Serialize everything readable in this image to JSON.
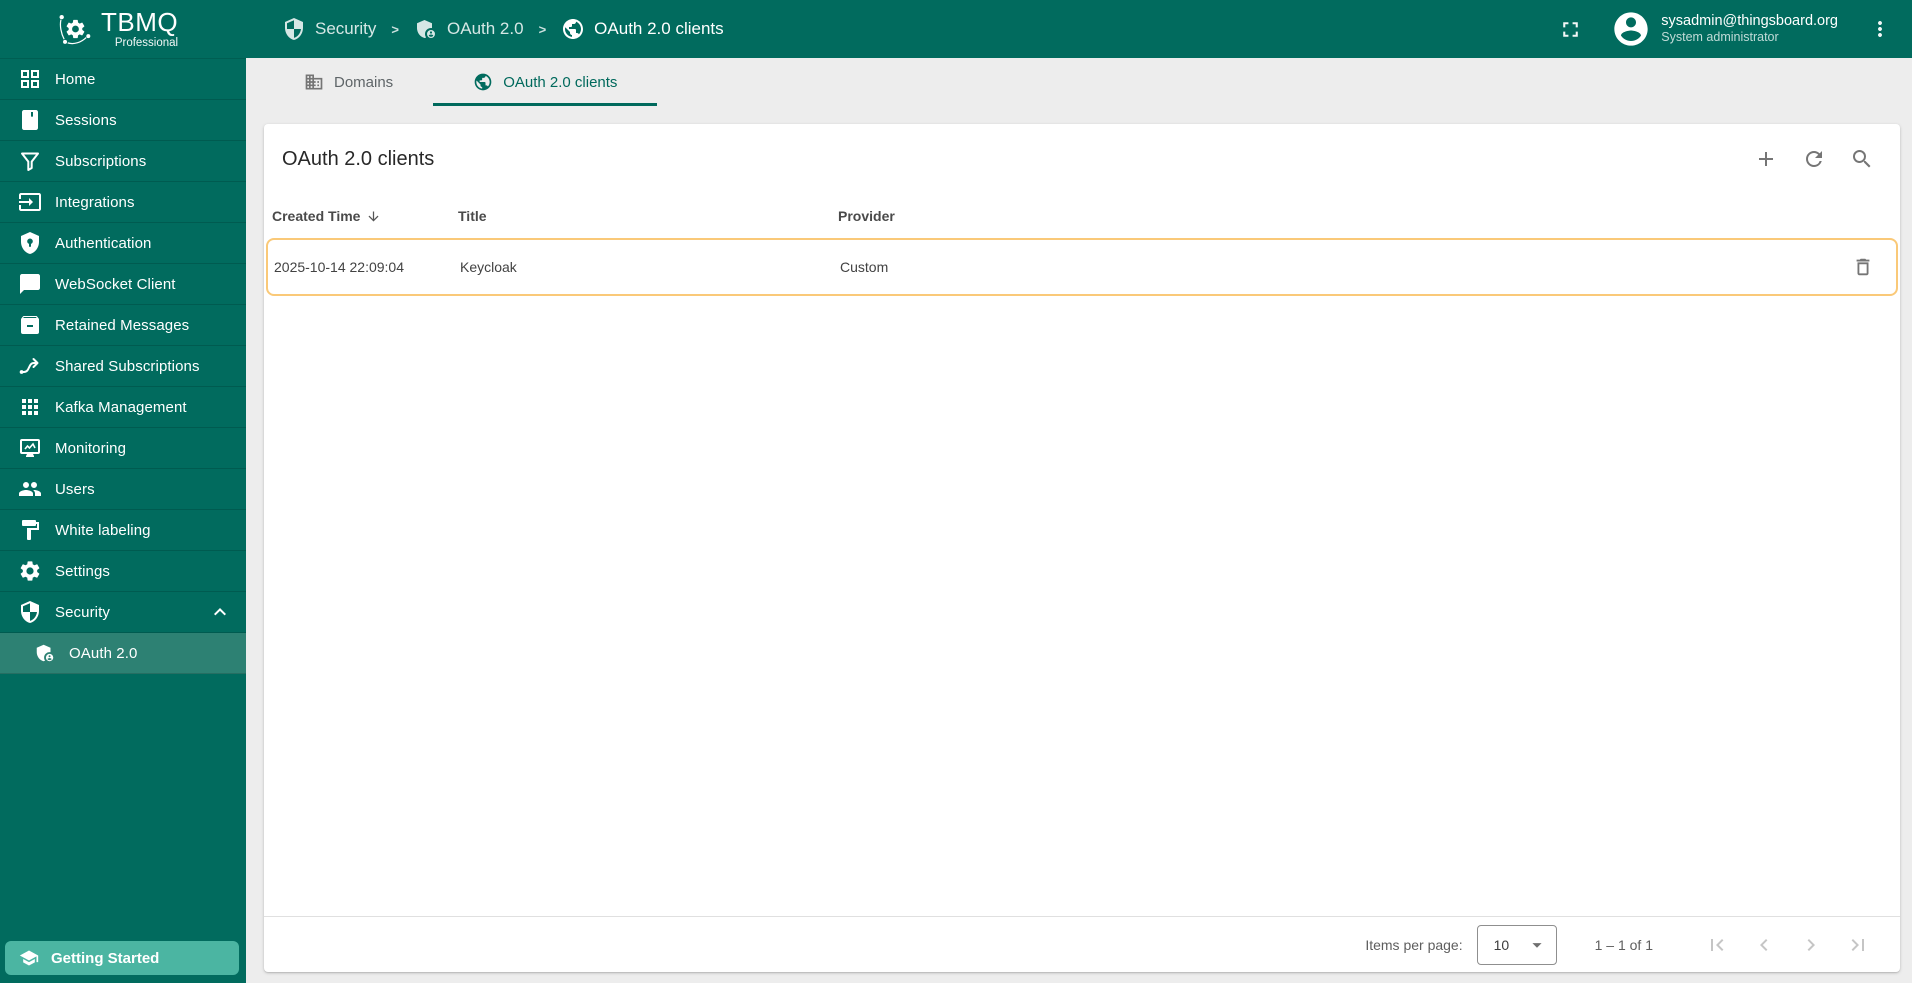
{
  "app": {
    "name": "TBMQ",
    "edition": "Professional"
  },
  "topbar": {
    "breadcrumb": [
      {
        "label": "Security"
      },
      {
        "label": "OAuth 2.0"
      },
      {
        "label": "OAuth 2.0 clients"
      }
    ],
    "user": {
      "email": "sysadmin@thingsboard.org",
      "role": "System administrator"
    }
  },
  "sidebar": {
    "items": [
      {
        "label": "Home"
      },
      {
        "label": "Sessions"
      },
      {
        "label": "Subscriptions"
      },
      {
        "label": "Integrations"
      },
      {
        "label": "Authentication"
      },
      {
        "label": "WebSocket Client"
      },
      {
        "label": "Retained Messages"
      },
      {
        "label": "Shared Subscriptions"
      },
      {
        "label": "Kafka Management"
      },
      {
        "label": "Monitoring"
      },
      {
        "label": "Users"
      },
      {
        "label": "White labeling"
      },
      {
        "label": "Settings"
      },
      {
        "label": "Security"
      }
    ],
    "security_child": {
      "label": "OAuth 2.0"
    },
    "getting_started": "Getting Started"
  },
  "tabs": {
    "domains": "Domains",
    "oauth_clients": "OAuth 2.0 clients"
  },
  "main": {
    "title": "OAuth 2.0 clients",
    "table": {
      "columns": {
        "created_time": "Created Time",
        "title": "Title",
        "provider": "Provider"
      },
      "rows": [
        {
          "created_time": "2025-10-14 22:09:04",
          "title": "Keycloak",
          "provider": "Custom"
        }
      ]
    },
    "paginator": {
      "items_per_page_label": "Items per page:",
      "page_size": "10",
      "range": "1 – 1 of 1"
    }
  },
  "colors": {
    "primary": "#016B5E",
    "sidebar_selected_bg": "#2D8173",
    "getting_started_bg": "#4BB5A2",
    "active_tab": "#00695C",
    "row_highlight_border": "#FAC978",
    "content_bg": "#EDEDED"
  }
}
